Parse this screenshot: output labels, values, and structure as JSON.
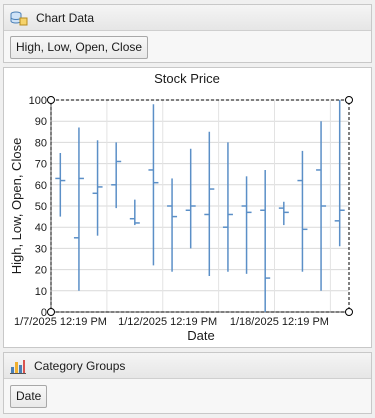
{
  "chart_data_panel": {
    "title": "Chart Data",
    "icon": "database-icon",
    "field_button": "High, Low, Open, Close"
  },
  "category_panel": {
    "title": "Category Groups",
    "icon": "bar-chart-icon",
    "field_button": "Date"
  },
  "colors": {
    "series": "#5b8fc7",
    "selection_handle": "#000000"
  },
  "chart_data": {
    "type": "stock-hloc",
    "title": "Stock Price",
    "xlabel": "Date",
    "ylabel": "High, Low, Open, Close",
    "ylim": [
      0,
      100
    ],
    "yticks": [
      0,
      10,
      20,
      30,
      40,
      50,
      60,
      70,
      80,
      90,
      100
    ],
    "x_tick_labels": [
      "1/7/2025 12:19 PM",
      "1/12/2025 12:19 PM",
      "1/18/2025 12:19 PM"
    ],
    "x_tick_index": [
      0,
      5,
      11
    ],
    "grid": true,
    "series": [
      {
        "name": "High",
        "values": [
          75,
          87,
          81,
          80,
          53,
          98,
          63,
          77,
          85,
          80,
          64,
          67,
          52,
          76,
          90,
          100
        ]
      },
      {
        "name": "Low",
        "values": [
          45,
          10,
          36,
          49,
          41,
          22,
          19,
          30,
          17,
          19,
          18,
          0,
          41,
          19,
          10,
          31
        ]
      },
      {
        "name": "Open",
        "values": [
          63,
          35,
          56,
          60,
          44,
          67,
          50,
          48,
          46,
          40,
          50,
          48,
          49,
          62,
          67,
          43
        ]
      },
      {
        "name": "Close",
        "values": [
          62,
          63,
          59,
          71,
          42,
          61,
          45,
          50,
          58,
          46,
          47,
          16,
          47,
          39,
          50,
          48
        ]
      }
    ]
  }
}
